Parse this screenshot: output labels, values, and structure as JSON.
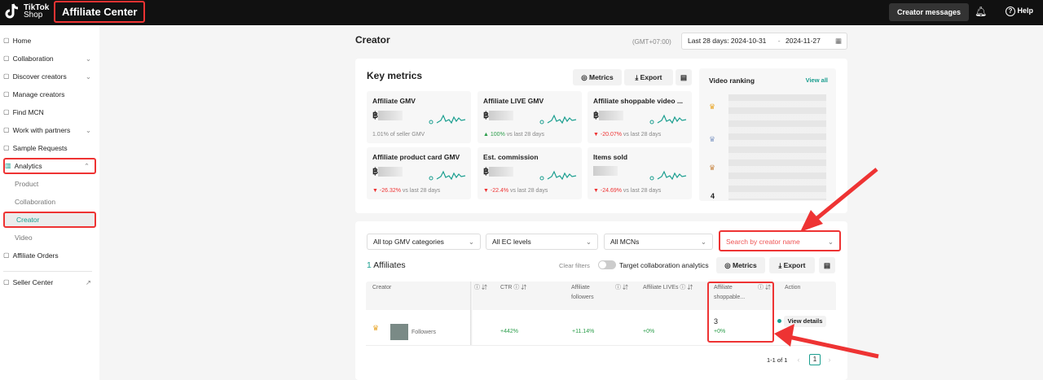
{
  "topbar": {
    "logo": "TikTok Shop",
    "logo_line1": "TikTok",
    "logo_line2": "Shop",
    "title": "Affiliate Center",
    "creator_messages": "Creator messages",
    "help": "Help"
  },
  "sidebar": {
    "items": [
      {
        "label": "Home",
        "icon": "home-icon"
      },
      {
        "label": "Collaboration",
        "icon": "collaboration-icon",
        "chevron": "down"
      },
      {
        "label": "Discover creators",
        "icon": "discover-icon",
        "chevron": "down"
      },
      {
        "label": "Manage creators",
        "icon": "users-icon"
      },
      {
        "label": "Find MCN",
        "icon": "building-icon"
      },
      {
        "label": "Work with partners",
        "icon": "building-icon",
        "chevron": "down"
      },
      {
        "label": "Sample Requests",
        "icon": "gift-icon"
      },
      {
        "label": "Analytics",
        "icon": "chart-icon",
        "chevron": "up"
      },
      {
        "label": "Product"
      },
      {
        "label": "Collaboration"
      },
      {
        "label": "Creator"
      },
      {
        "label": "Video"
      },
      {
        "label": "Affiliate Orders",
        "icon": "clipboard-icon"
      },
      {
        "label": "Seller Center",
        "icon": "store-icon"
      }
    ]
  },
  "page": {
    "title": "Creator",
    "timezone": "(GMT+07:00)",
    "date_label": "Last 28 days: 2024-10-31",
    "date_sep": "-",
    "date_end": "2024-11-27"
  },
  "key_metrics": {
    "title": "Key metrics",
    "metrics_btn": "Metrics",
    "export_btn": "Export",
    "cards": [
      {
        "title": "Affiliate GMV",
        "currency": "฿",
        "change": "1.01%",
        "suffix": "of seller GMV",
        "dir": "none"
      },
      {
        "title": "Affiliate LIVE GMV",
        "currency": "฿",
        "change": "100%",
        "suffix": "vs last 28 days",
        "dir": "up"
      },
      {
        "title": "Affiliate shoppable video ...",
        "currency": "฿",
        "change": "-20.07%",
        "suffix": "vs last 28 days",
        "dir": "down"
      },
      {
        "title": "Affiliate product card GMV",
        "currency": "฿",
        "change": "-26.32%",
        "suffix": "vs last 28 days",
        "dir": "down"
      },
      {
        "title": "Est. commission",
        "currency": "฿",
        "change": "-22.4%",
        "suffix": "vs last 28 days",
        "dir": "down"
      },
      {
        "title": "Items sold",
        "currency": "",
        "change": "-24.69%",
        "suffix": "vs last 28 days",
        "dir": "down"
      }
    ]
  },
  "video_ranking": {
    "title": "Video ranking",
    "view_all": "View all",
    "rank4": "4"
  },
  "filters": {
    "categories": "All top GMV categories",
    "ec_levels": "All EC levels",
    "mcns": "All MCNs",
    "search_placeholder": "Search by creator name"
  },
  "affiliates": {
    "count": "1",
    "label": "Affiliates",
    "clear_filters": "Clear filters",
    "toggle_label": "Target collaboration analytics",
    "metrics_btn": "Metrics",
    "export_btn": "Export"
  },
  "table": {
    "headers": [
      "Creator",
      "CTR",
      "Affiliate followers",
      "Affiliate LIVEs",
      "Affiliate shoppable...",
      "Action"
    ],
    "row": {
      "followers_label": "Followers",
      "ctr_change": "+442%",
      "followers_change": "+11.14%",
      "lives_change": "+0%",
      "shoppable_value": "3",
      "shoppable_change": "+0%",
      "action": "View details"
    }
  },
  "pagination": {
    "range": "1-1 of 1",
    "page": "1"
  },
  "colors": {
    "accent": "#1a9e8f",
    "highlight": "#e33333"
  }
}
